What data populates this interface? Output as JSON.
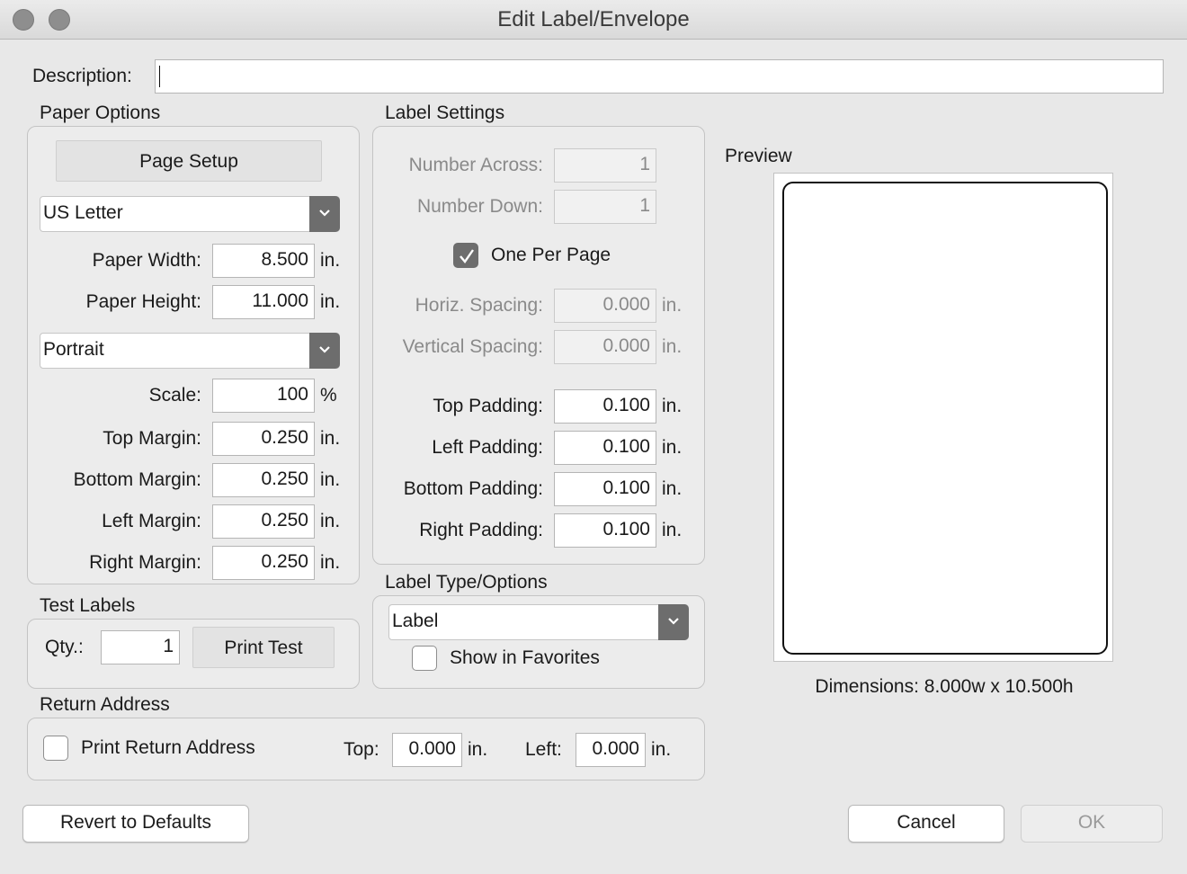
{
  "window": {
    "title": "Edit Label/Envelope"
  },
  "description": {
    "label": "Description:",
    "value": ""
  },
  "paper_options": {
    "heading": "Paper Options",
    "page_setup_label": "Page Setup",
    "paper_size": "US Letter",
    "paper_width": {
      "label": "Paper Width:",
      "value": "8.500",
      "unit": "in."
    },
    "paper_height": {
      "label": "Paper Height:",
      "value": "11.000",
      "unit": "in."
    },
    "orientation": "Portrait",
    "scale": {
      "label": "Scale:",
      "value": "100",
      "unit": "%"
    },
    "top_margin": {
      "label": "Top Margin:",
      "value": "0.250",
      "unit": "in."
    },
    "bottom_margin": {
      "label": "Bottom Margin:",
      "value": "0.250",
      "unit": "in."
    },
    "left_margin": {
      "label": "Left Margin:",
      "value": "0.250",
      "unit": "in."
    },
    "right_margin": {
      "label": "Right Margin:",
      "value": "0.250",
      "unit": "in."
    }
  },
  "label_settings": {
    "heading": "Label Settings",
    "number_across": {
      "label": "Number Across:",
      "value": "1"
    },
    "number_down": {
      "label": "Number Down:",
      "value": "1"
    },
    "one_per_page": {
      "label": "One Per Page",
      "checked": true
    },
    "horiz_spacing": {
      "label": "Horiz. Spacing:",
      "value": "0.000",
      "unit": "in."
    },
    "vertical_spacing": {
      "label": "Vertical Spacing:",
      "value": "0.000",
      "unit": "in."
    },
    "top_padding": {
      "label": "Top Padding:",
      "value": "0.100",
      "unit": "in."
    },
    "left_padding": {
      "label": "Left Padding:",
      "value": "0.100",
      "unit": "in."
    },
    "bottom_padding": {
      "label": "Bottom Padding:",
      "value": "0.100",
      "unit": "in."
    },
    "right_padding": {
      "label": "Right Padding:",
      "value": "0.100",
      "unit": "in."
    }
  },
  "test_labels": {
    "heading": "Test Labels",
    "qty_label": "Qty.:",
    "qty_value": "1",
    "print_test_label": "Print Test"
  },
  "label_type": {
    "heading": "Label Type/Options",
    "selected": "Label",
    "show_in_favorites": {
      "label": "Show in Favorites",
      "checked": false
    }
  },
  "return_address": {
    "heading": "Return Address",
    "print_label": "Print Return Address",
    "print_checked": false,
    "top": {
      "label": "Top:",
      "value": "0.000",
      "unit": "in."
    },
    "left": {
      "label": "Left:",
      "value": "0.000",
      "unit": "in."
    }
  },
  "preview": {
    "heading": "Preview",
    "dimensions": "Dimensions: 8.000w x 10.500h"
  },
  "buttons": {
    "revert": "Revert to Defaults",
    "cancel": "Cancel",
    "ok": "OK"
  }
}
